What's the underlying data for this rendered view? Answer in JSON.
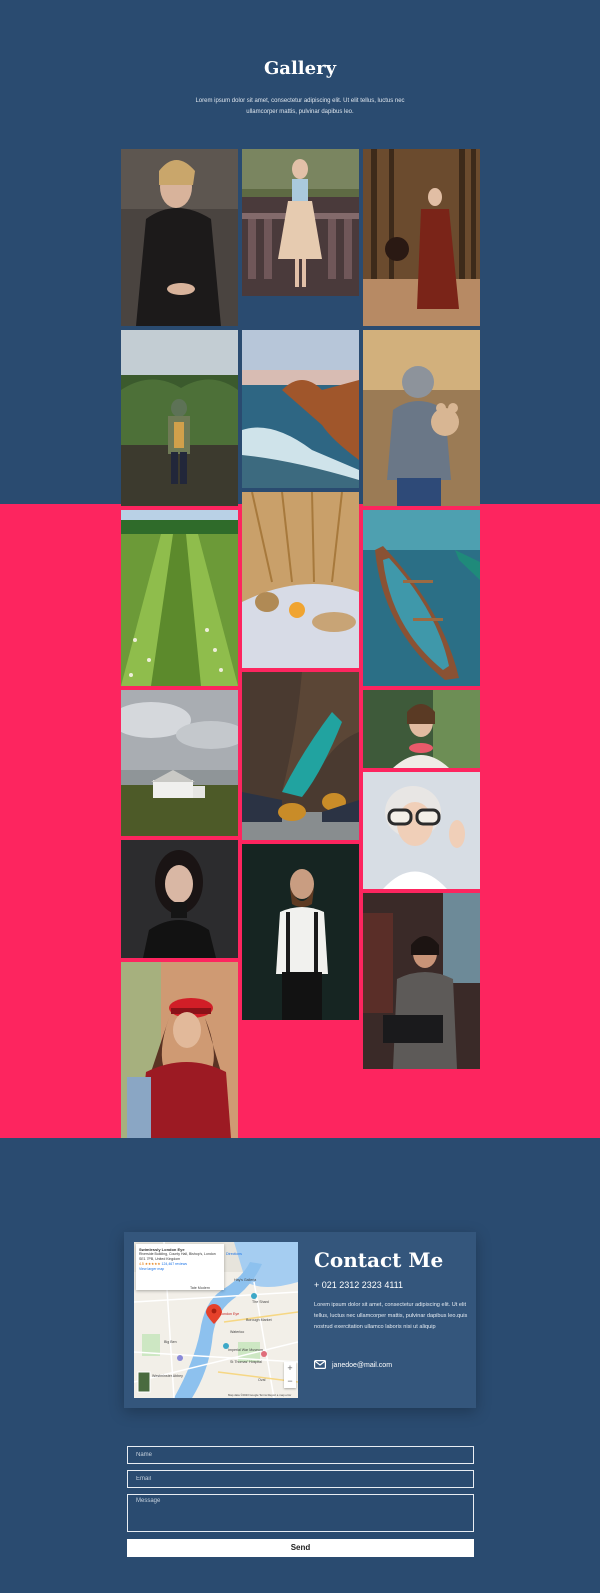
{
  "gallery": {
    "title": "Gallery",
    "subtitle": "Lorem ipsum dolor sit amet, consectetur adipiscing elit. Ut elit tellus, luctus nec ullamcorper mattis, pulvinar dapibus leo."
  },
  "colors": {
    "navy": "#2a4b70",
    "pink": "#fd255f",
    "card": "#34567c"
  },
  "photos": [
    "woman-black-coat",
    "woman-skirt-balcony",
    "woman-hat-forest",
    "man-green-bushes",
    "coastal-cliffs",
    "child-teddy-bear",
    "green-meadow",
    "picnic-wheat-field",
    "wooden-boats",
    "white-farmhouse",
    "boots-over-river",
    "woman-headphones",
    "woman-dark-turtleneck",
    "bearded-man-suspenders",
    "woman-white-sunglasses",
    "woman-red-cap",
    "woman-typewriter"
  ],
  "map": {
    "place_name": "Swimlessly London Eye",
    "address": "Riverside Building, County Hall, Bishop's, London SE1 7PB, United Kingdom",
    "rating": "4.5 ★★★★★",
    "reviews": "124,467 reviews",
    "view_larger": "View larger map",
    "directions": "Directions",
    "labels": [
      "Hay's Galleria",
      "The Shard",
      "Borough Market",
      "Tate Modern",
      "Waterloo",
      "London Eye",
      "Westminster Abbey",
      "Big Ben",
      "St Thomas' Hospital",
      "Imperial War Museum",
      "Oval"
    ],
    "footer": "Map data ©2023 Google  Terms  Report a map error"
  },
  "contact": {
    "title": "Contact Me",
    "phone": "+ 021 2312 2323 4111",
    "text": "Lorem ipsum dolor sit amet, consectetur adipiscing elit. Ut elit tellus, luctus nec ullamcorper mattis, pulvinar dapibus leo.quis nostrud exercitation ullamco laboris nisi ut aliquip",
    "email": "janedoe@mail.com"
  },
  "form": {
    "name_placeholder": "Name",
    "email_placeholder": "Email",
    "message_placeholder": "Message",
    "send_label": "Send"
  }
}
